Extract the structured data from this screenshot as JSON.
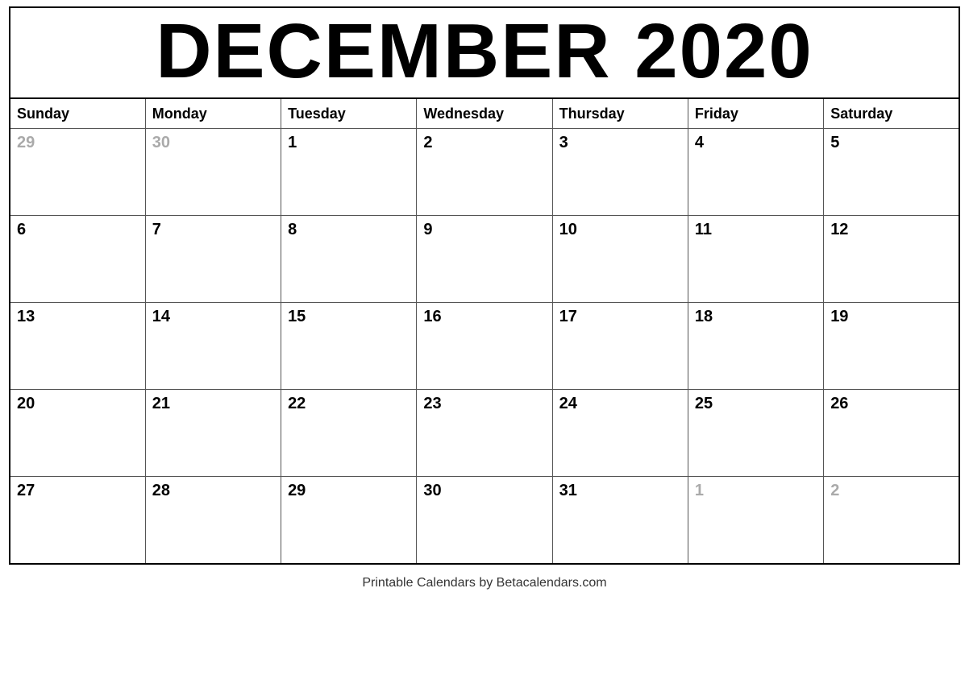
{
  "title": "DECEMBER 2020",
  "days_of_week": [
    "Sunday",
    "Monday",
    "Tuesday",
    "Wednesday",
    "Thursday",
    "Friday",
    "Saturday"
  ],
  "weeks": [
    [
      {
        "day": "29",
        "other": true
      },
      {
        "day": "30",
        "other": true
      },
      {
        "day": "1",
        "other": false
      },
      {
        "day": "2",
        "other": false
      },
      {
        "day": "3",
        "other": false
      },
      {
        "day": "4",
        "other": false
      },
      {
        "day": "5",
        "other": false
      }
    ],
    [
      {
        "day": "6",
        "other": false
      },
      {
        "day": "7",
        "other": false
      },
      {
        "day": "8",
        "other": false
      },
      {
        "day": "9",
        "other": false
      },
      {
        "day": "10",
        "other": false
      },
      {
        "day": "11",
        "other": false
      },
      {
        "day": "12",
        "other": false
      }
    ],
    [
      {
        "day": "13",
        "other": false
      },
      {
        "day": "14",
        "other": false
      },
      {
        "day": "15",
        "other": false
      },
      {
        "day": "16",
        "other": false
      },
      {
        "day": "17",
        "other": false
      },
      {
        "day": "18",
        "other": false
      },
      {
        "day": "19",
        "other": false
      }
    ],
    [
      {
        "day": "20",
        "other": false
      },
      {
        "day": "21",
        "other": false
      },
      {
        "day": "22",
        "other": false
      },
      {
        "day": "23",
        "other": false
      },
      {
        "day": "24",
        "other": false
      },
      {
        "day": "25",
        "other": false
      },
      {
        "day": "26",
        "other": false
      }
    ],
    [
      {
        "day": "27",
        "other": false
      },
      {
        "day": "28",
        "other": false
      },
      {
        "day": "29",
        "other": false
      },
      {
        "day": "30",
        "other": false
      },
      {
        "day": "31",
        "other": false
      },
      {
        "day": "1",
        "other": true
      },
      {
        "day": "2",
        "other": true
      }
    ]
  ],
  "footer": "Printable Calendars by Betacalendars.com"
}
